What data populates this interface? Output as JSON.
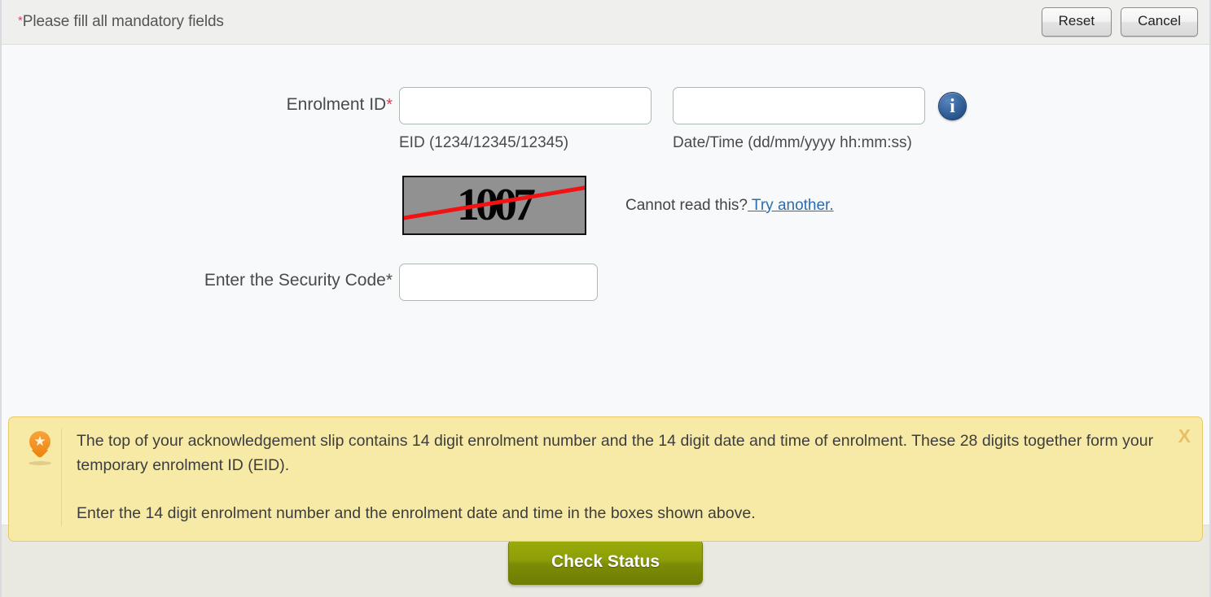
{
  "header": {
    "mandatory_note": "Please fill all mandatory fields",
    "required_marker": "*",
    "reset_label": "Reset",
    "cancel_label": "Cancel"
  },
  "form": {
    "enrolment_id": {
      "label": "Enrolment ID",
      "required_marker": "*",
      "eid_value": "",
      "eid_placeholder": "",
      "eid_hint": "EID (1234/12345/12345)",
      "datetime_value": "",
      "datetime_placeholder": "",
      "datetime_hint": "Date/Time (dd/mm/yyyy hh:mm:ss)",
      "info_icon_glyph": "i"
    },
    "captcha": {
      "code_text": "1007",
      "cannot_read_text": "Cannot read this?",
      "try_another_label": " Try another.",
      "background_color": "#919191",
      "strike_color": "#f21212"
    },
    "security_code": {
      "label": "Enter the Security Code",
      "required_marker": "*",
      "value": "",
      "placeholder": ""
    }
  },
  "notice": {
    "paragraph_1": "The top of your acknowledgement slip contains 14 digit enrolment number and the 14 digit date and time of enrolment. These 28 digits together form your temporary enrolment ID (EID).",
    "paragraph_2": "Enter the 14 digit enrolment number and the enrolment date and time in the boxes shown above.",
    "close_label": "X",
    "star_glyph": "★",
    "background_color": "#f7eaa6",
    "border_color": "#e5c96a",
    "pin_color": "#f08a18"
  },
  "footer": {
    "check_status_label": "Check Status",
    "button_color": "#8d9e07"
  }
}
